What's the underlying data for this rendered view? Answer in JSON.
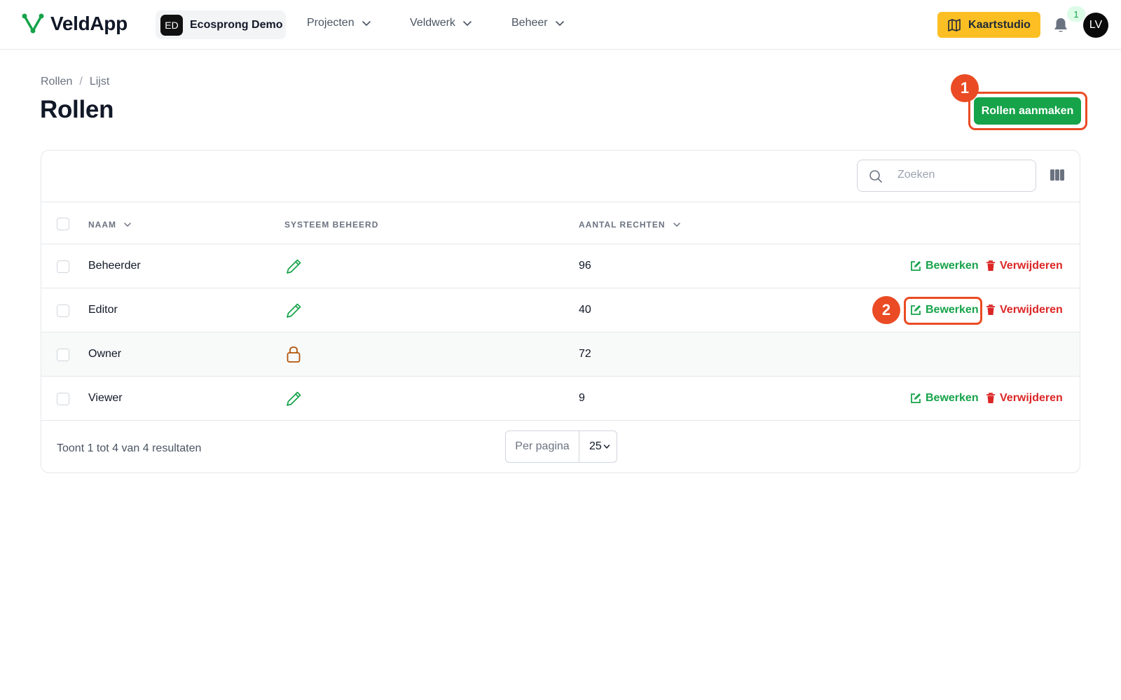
{
  "app": {
    "name": "VeldApp"
  },
  "tenant": {
    "initials": "ED",
    "name": "Ecosprong Demo"
  },
  "nav": [
    {
      "label": "Projecten"
    },
    {
      "label": "Veldwerk"
    },
    {
      "label": "Beheer"
    }
  ],
  "topbar": {
    "map_button": "Kaartstudio",
    "notifications_count": "1",
    "user_initials": "LV"
  },
  "breadcrumb": {
    "root": "Rollen",
    "current": "Lijst",
    "separator": "/"
  },
  "page": {
    "title": "Rollen",
    "create_button": "Rollen aanmaken"
  },
  "markers": {
    "one": "1",
    "two": "2"
  },
  "search": {
    "placeholder": "Zoeken",
    "value": ""
  },
  "table": {
    "columns": {
      "name": "NAAM",
      "system": "SYSTEEM BEHEERD",
      "rights": "AANTAL RECHTEN"
    },
    "rows": [
      {
        "name": "Beheerder",
        "system_icon": "pencil-icon",
        "rights": "96",
        "edit": "Bewerken",
        "delete": "Verwijderen"
      },
      {
        "name": "Editor",
        "system_icon": "pencil-icon",
        "rights": "40",
        "edit": "Bewerken",
        "delete": "Verwijderen"
      },
      {
        "name": "Owner",
        "system_icon": "lock-icon",
        "rights": "72"
      },
      {
        "name": "Viewer",
        "system_icon": "pencil-icon",
        "rights": "9",
        "edit": "Bewerken",
        "delete": "Verwijderen"
      }
    ]
  },
  "footer": {
    "summary": "Toont 1 tot 4 van 4 resultaten",
    "per_page_label": "Per pagina",
    "per_page_value": "25"
  },
  "colors": {
    "brand_green": "#16a34a",
    "accent_yellow": "#fbbf24",
    "danger_red": "#dc2626",
    "marker_orange": "#ea4b24"
  }
}
